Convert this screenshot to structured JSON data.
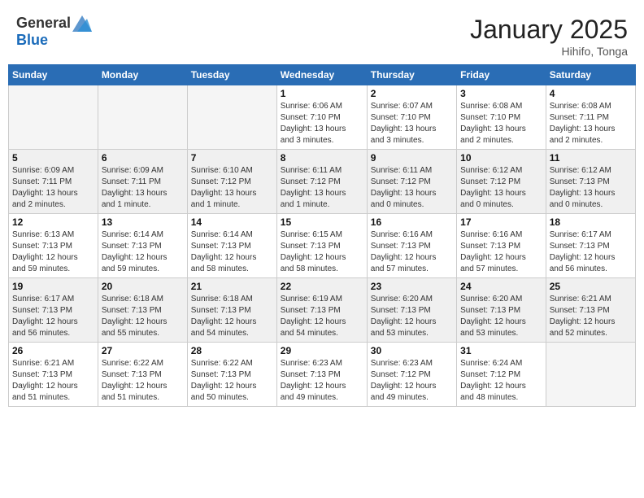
{
  "header": {
    "logo_general": "General",
    "logo_blue": "Blue",
    "month": "January 2025",
    "location": "Hihifo, Tonga"
  },
  "weekdays": [
    "Sunday",
    "Monday",
    "Tuesday",
    "Wednesday",
    "Thursday",
    "Friday",
    "Saturday"
  ],
  "weeks": [
    [
      {
        "day": "",
        "info": ""
      },
      {
        "day": "",
        "info": ""
      },
      {
        "day": "",
        "info": ""
      },
      {
        "day": "1",
        "info": "Sunrise: 6:06 AM\nSunset: 7:10 PM\nDaylight: 13 hours\nand 3 minutes."
      },
      {
        "day": "2",
        "info": "Sunrise: 6:07 AM\nSunset: 7:10 PM\nDaylight: 13 hours\nand 3 minutes."
      },
      {
        "day": "3",
        "info": "Sunrise: 6:08 AM\nSunset: 7:10 PM\nDaylight: 13 hours\nand 2 minutes."
      },
      {
        "day": "4",
        "info": "Sunrise: 6:08 AM\nSunset: 7:11 PM\nDaylight: 13 hours\nand 2 minutes."
      }
    ],
    [
      {
        "day": "5",
        "info": "Sunrise: 6:09 AM\nSunset: 7:11 PM\nDaylight: 13 hours\nand 2 minutes."
      },
      {
        "day": "6",
        "info": "Sunrise: 6:09 AM\nSunset: 7:11 PM\nDaylight: 13 hours\nand 1 minute."
      },
      {
        "day": "7",
        "info": "Sunrise: 6:10 AM\nSunset: 7:12 PM\nDaylight: 13 hours\nand 1 minute."
      },
      {
        "day": "8",
        "info": "Sunrise: 6:11 AM\nSunset: 7:12 PM\nDaylight: 13 hours\nand 1 minute."
      },
      {
        "day": "9",
        "info": "Sunrise: 6:11 AM\nSunset: 7:12 PM\nDaylight: 13 hours\nand 0 minutes."
      },
      {
        "day": "10",
        "info": "Sunrise: 6:12 AM\nSunset: 7:12 PM\nDaylight: 13 hours\nand 0 minutes."
      },
      {
        "day": "11",
        "info": "Sunrise: 6:12 AM\nSunset: 7:13 PM\nDaylight: 13 hours\nand 0 minutes."
      }
    ],
    [
      {
        "day": "12",
        "info": "Sunrise: 6:13 AM\nSunset: 7:13 PM\nDaylight: 12 hours\nand 59 minutes."
      },
      {
        "day": "13",
        "info": "Sunrise: 6:14 AM\nSunset: 7:13 PM\nDaylight: 12 hours\nand 59 minutes."
      },
      {
        "day": "14",
        "info": "Sunrise: 6:14 AM\nSunset: 7:13 PM\nDaylight: 12 hours\nand 58 minutes."
      },
      {
        "day": "15",
        "info": "Sunrise: 6:15 AM\nSunset: 7:13 PM\nDaylight: 12 hours\nand 58 minutes."
      },
      {
        "day": "16",
        "info": "Sunrise: 6:16 AM\nSunset: 7:13 PM\nDaylight: 12 hours\nand 57 minutes."
      },
      {
        "day": "17",
        "info": "Sunrise: 6:16 AM\nSunset: 7:13 PM\nDaylight: 12 hours\nand 57 minutes."
      },
      {
        "day": "18",
        "info": "Sunrise: 6:17 AM\nSunset: 7:13 PM\nDaylight: 12 hours\nand 56 minutes."
      }
    ],
    [
      {
        "day": "19",
        "info": "Sunrise: 6:17 AM\nSunset: 7:13 PM\nDaylight: 12 hours\nand 56 minutes."
      },
      {
        "day": "20",
        "info": "Sunrise: 6:18 AM\nSunset: 7:13 PM\nDaylight: 12 hours\nand 55 minutes."
      },
      {
        "day": "21",
        "info": "Sunrise: 6:18 AM\nSunset: 7:13 PM\nDaylight: 12 hours\nand 54 minutes."
      },
      {
        "day": "22",
        "info": "Sunrise: 6:19 AM\nSunset: 7:13 PM\nDaylight: 12 hours\nand 54 minutes."
      },
      {
        "day": "23",
        "info": "Sunrise: 6:20 AM\nSunset: 7:13 PM\nDaylight: 12 hours\nand 53 minutes."
      },
      {
        "day": "24",
        "info": "Sunrise: 6:20 AM\nSunset: 7:13 PM\nDaylight: 12 hours\nand 53 minutes."
      },
      {
        "day": "25",
        "info": "Sunrise: 6:21 AM\nSunset: 7:13 PM\nDaylight: 12 hours\nand 52 minutes."
      }
    ],
    [
      {
        "day": "26",
        "info": "Sunrise: 6:21 AM\nSunset: 7:13 PM\nDaylight: 12 hours\nand 51 minutes."
      },
      {
        "day": "27",
        "info": "Sunrise: 6:22 AM\nSunset: 7:13 PM\nDaylight: 12 hours\nand 51 minutes."
      },
      {
        "day": "28",
        "info": "Sunrise: 6:22 AM\nSunset: 7:13 PM\nDaylight: 12 hours\nand 50 minutes."
      },
      {
        "day": "29",
        "info": "Sunrise: 6:23 AM\nSunset: 7:13 PM\nDaylight: 12 hours\nand 49 minutes."
      },
      {
        "day": "30",
        "info": "Sunrise: 6:23 AM\nSunset: 7:12 PM\nDaylight: 12 hours\nand 49 minutes."
      },
      {
        "day": "31",
        "info": "Sunrise: 6:24 AM\nSunset: 7:12 PM\nDaylight: 12 hours\nand 48 minutes."
      },
      {
        "day": "",
        "info": ""
      }
    ]
  ]
}
